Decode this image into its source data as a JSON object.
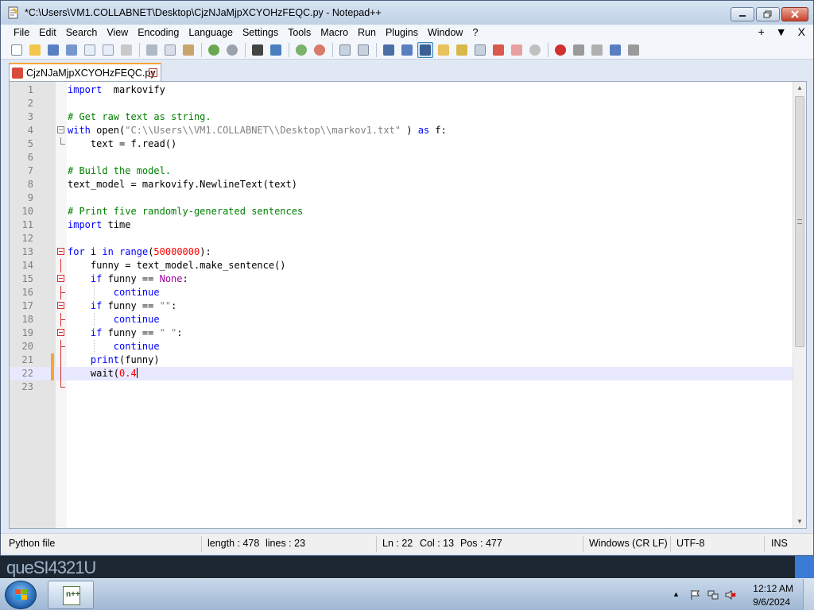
{
  "window": {
    "title": "*C:\\Users\\VM1.COLLABNET\\Desktop\\CjzNJaMjpXCYOHzFEQC.py - Notepad++"
  },
  "menu": {
    "items": [
      "File",
      "Edit",
      "Search",
      "View",
      "Encoding",
      "Language",
      "Settings",
      "Tools",
      "Macro",
      "Run",
      "Plugins",
      "Window",
      "?"
    ],
    "right": [
      "+",
      "▼",
      "X"
    ]
  },
  "toolbar": {
    "icons": [
      "new-file-icon",
      "open-file-icon",
      "save-icon",
      "save-all-icon",
      "close-icon",
      "close-all-icon",
      "print-icon",
      "cut-icon",
      "copy-icon",
      "paste-icon",
      "undo-icon",
      "redo-icon",
      "find-icon",
      "replace-icon",
      "zoom-in-icon",
      "zoom-out-icon",
      "sync-vertical-icon",
      "sync-horizontal-icon",
      "word-wrap-icon",
      "show-all-chars-icon",
      "indent-guide-icon",
      "user-defined-language-icon",
      "document-map-icon",
      "function-list-icon",
      "folder-workspace-icon",
      "monitoring-icon",
      "record-macro-icon",
      "stop-record-icon",
      "play-macro-icon",
      "run-macro-multiple-icon",
      "save-macro-icon"
    ]
  },
  "tab": {
    "label": "CjzNJaMjpXCYOHzFEQC.py",
    "close": "x"
  },
  "editor": {
    "lines": [
      {
        "n": "1",
        "segs": [
          [
            "kw",
            "import"
          ],
          [
            "",
            "  markovify"
          ]
        ]
      },
      {
        "n": "2",
        "segs": []
      },
      {
        "n": "3",
        "segs": [
          [
            "cm",
            "# Get raw text as string."
          ]
        ]
      },
      {
        "n": "4",
        "segs": [
          [
            "kw",
            "with"
          ],
          [
            "",
            " open("
          ],
          [
            "st",
            "\"C:\\\\Users\\\\VM1.COLLABNET\\\\Desktop\\\\markov1.txt\""
          ],
          [
            "",
            " ) "
          ],
          [
            "kw",
            "as"
          ],
          [
            "",
            " f:"
          ]
        ]
      },
      {
        "n": "5",
        "segs": [
          [
            "",
            "    text = f.read()"
          ]
        ]
      },
      {
        "n": "6",
        "segs": []
      },
      {
        "n": "7",
        "segs": [
          [
            "cm",
            "# Build the model."
          ]
        ]
      },
      {
        "n": "8",
        "segs": [
          [
            "",
            "text_model = markovify.NewlineText(text)"
          ]
        ]
      },
      {
        "n": "9",
        "segs": []
      },
      {
        "n": "10",
        "segs": [
          [
            "cm",
            "# Print five randomly-generated sentences"
          ]
        ]
      },
      {
        "n": "11",
        "segs": [
          [
            "kw",
            "import"
          ],
          [
            "",
            " time"
          ]
        ]
      },
      {
        "n": "12",
        "segs": []
      },
      {
        "n": "13",
        "segs": [
          [
            "kw",
            "for"
          ],
          [
            "",
            " i "
          ],
          [
            "kw",
            "in"
          ],
          [
            "",
            " "
          ],
          [
            "kw",
            "range"
          ],
          [
            "",
            "("
          ],
          [
            "nm",
            "50000000"
          ],
          [
            "",
            "):"
          ]
        ]
      },
      {
        "n": "14",
        "segs": [
          [
            "",
            "    funny = text_model.make_sentence()"
          ]
        ]
      },
      {
        "n": "15",
        "segs": [
          [
            "",
            "    "
          ],
          [
            "kw",
            "if"
          ],
          [
            "",
            " funny == "
          ],
          [
            "kc",
            "None"
          ],
          [
            "",
            ":"
          ]
        ]
      },
      {
        "n": "16",
        "segs": [
          [
            "",
            "        "
          ],
          [
            "kw",
            "continue"
          ]
        ]
      },
      {
        "n": "17",
        "segs": [
          [
            "",
            "    "
          ],
          [
            "kw",
            "if"
          ],
          [
            "",
            " funny == "
          ],
          [
            "st",
            "\"\""
          ],
          [
            "",
            ":"
          ]
        ]
      },
      {
        "n": "18",
        "segs": [
          [
            "",
            "        "
          ],
          [
            "kw",
            "continue"
          ]
        ]
      },
      {
        "n": "19",
        "segs": [
          [
            "",
            "    "
          ],
          [
            "kw",
            "if"
          ],
          [
            "",
            " funny == "
          ],
          [
            "st",
            "\" \""
          ],
          [
            "",
            ":"
          ]
        ]
      },
      {
        "n": "20",
        "segs": [
          [
            "",
            "        "
          ],
          [
            "kw",
            "continue"
          ]
        ]
      },
      {
        "n": "21",
        "segs": [
          [
            "",
            "    "
          ],
          [
            "kw",
            "print"
          ],
          [
            "",
            "(funny)"
          ]
        ]
      },
      {
        "n": "22",
        "segs": [
          [
            "",
            "    wait("
          ],
          [
            "nm",
            "0.4"
          ]
        ]
      },
      {
        "n": "23",
        "segs": []
      }
    ],
    "current_line": "22"
  },
  "status": {
    "lang": "Python file",
    "length": "length : 478",
    "lines": "lines : 23",
    "ln": "Ln : 22",
    "col": "Col : 13",
    "pos": "Pos : 477",
    "eol": "Windows (CR LF)",
    "encoding": "UTF-8",
    "mode": "INS"
  },
  "taskbar": {
    "desktop_text": "queSI4321U",
    "time": "12:12 AM",
    "date": "9/6/2024",
    "tray_arrow": "▲"
  }
}
